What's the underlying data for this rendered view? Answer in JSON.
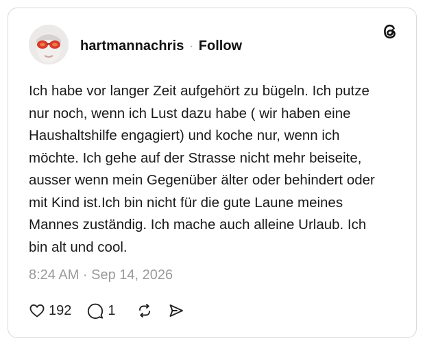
{
  "post": {
    "username": "hartmannachris",
    "separator": "·",
    "follow_label": "Follow",
    "text": "Ich habe vor langer Zeit aufgehört zu bügeln. Ich putze nur noch, wenn ich Lust dazu habe ( wir haben eine Haushaltshilfe engagiert) und koche nur, wenn ich möchte. Ich gehe auf der Strasse nicht mehr beiseite, ausser wenn mein Gegenüber älter oder behindert oder mit Kind ist.Ich bin nicht für die gute Laune meines Mannes zuständig. Ich mache auch alleine Urlaub. Ich bin alt und cool.",
    "timestamp": "8:24 AM · Sep 14, 2026"
  },
  "actions": {
    "likes": "192",
    "replies": "1"
  },
  "icons": {
    "logo": "threads-logo-icon",
    "like": "heart-icon",
    "reply": "comment-icon",
    "repost": "repost-icon",
    "share": "send-icon"
  },
  "colors": {
    "text": "#1a1a1a",
    "muted": "#9a9a9a",
    "border": "#d9d9d9"
  }
}
